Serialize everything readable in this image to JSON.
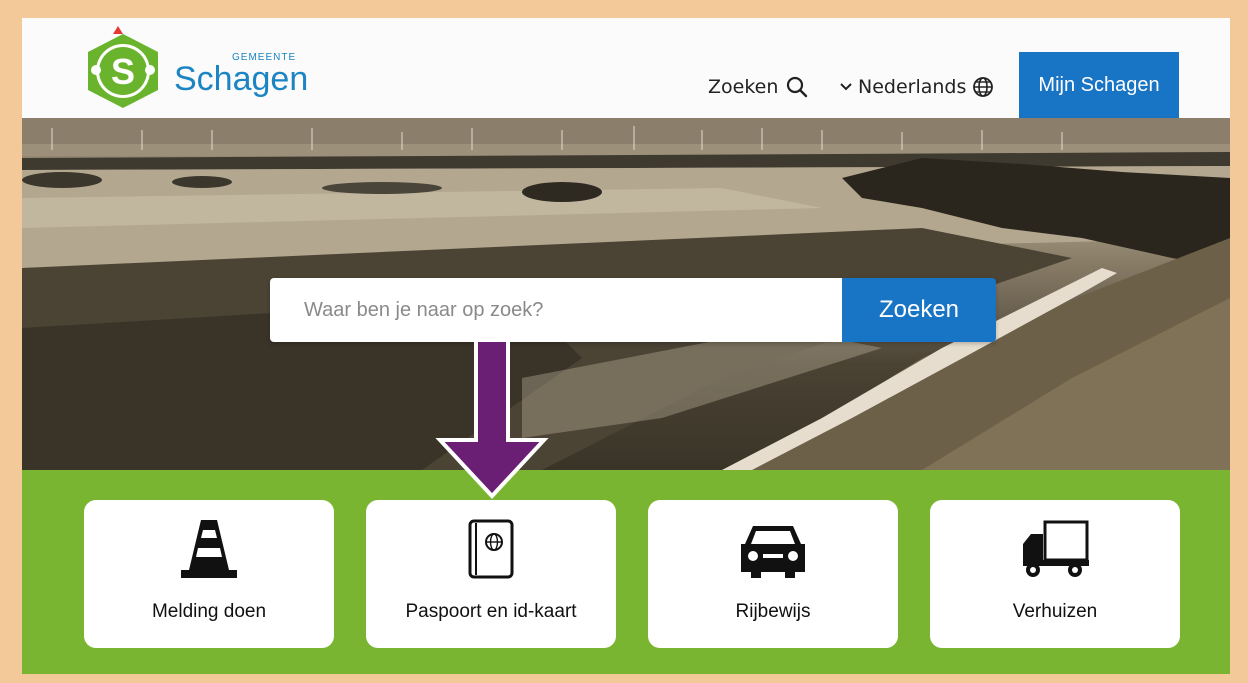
{
  "header": {
    "logo_small": "GEMEENTE",
    "logo_big": "Schagen",
    "logo_letter": "S",
    "search_label": "Zoeken",
    "language_label": "Nederlands",
    "account_button": "Mijn Schagen"
  },
  "hero": {
    "search_placeholder": "Waar ben je naar op zoek?",
    "search_button": "Zoeken"
  },
  "tiles": [
    {
      "label": "Melding doen",
      "icon": "traffic-cone-icon"
    },
    {
      "label": "Paspoort en id-kaart",
      "icon": "passport-icon"
    },
    {
      "label": "Rijbewijs",
      "icon": "car-icon"
    },
    {
      "label": "Verhuizen",
      "icon": "moving-truck-icon"
    }
  ],
  "colors": {
    "brand_blue": "#1874c4",
    "brand_green": "#79b531",
    "arrow_purple": "#6a1e74",
    "frame": "#f3c99a"
  }
}
